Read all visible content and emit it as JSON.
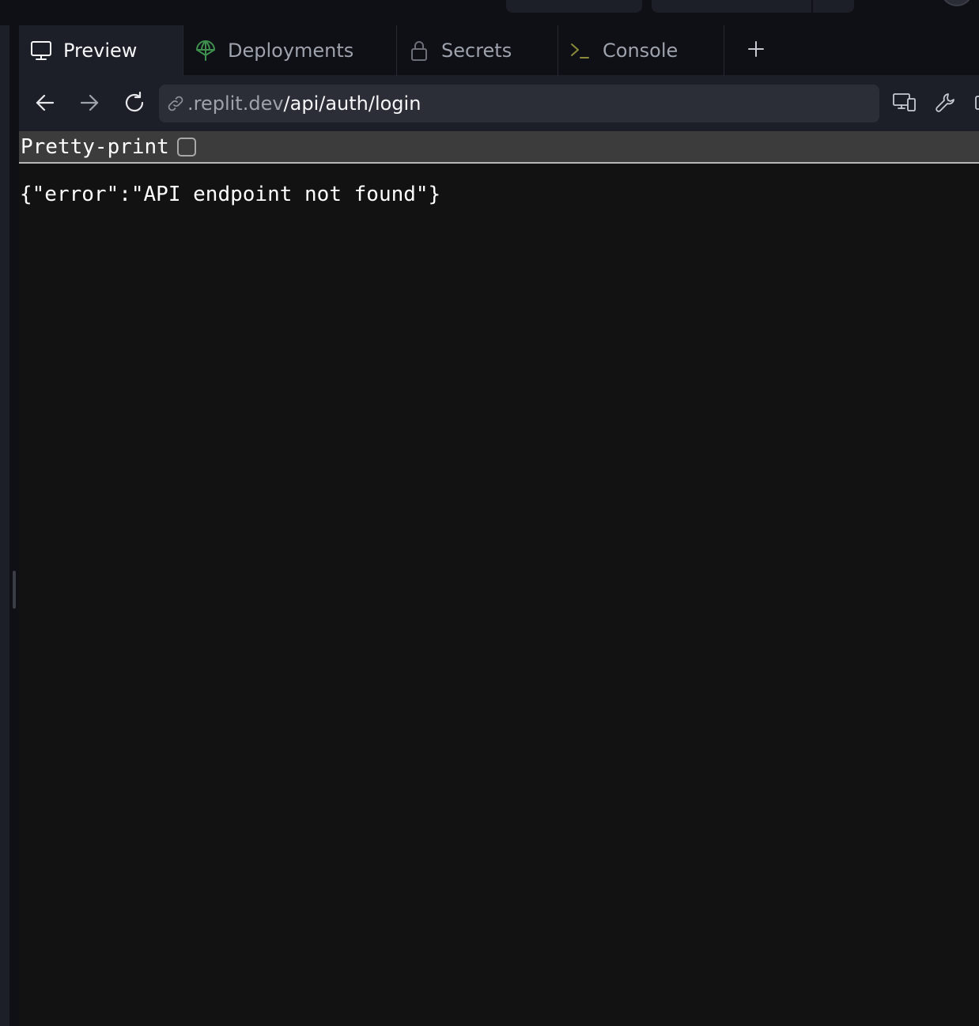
{
  "tabs": [
    {
      "label": "Preview",
      "icon": "monitor-icon",
      "active": true
    },
    {
      "label": "Deployments",
      "icon": "deployments-icon",
      "active": false
    },
    {
      "label": "Secrets",
      "icon": "lock-icon",
      "active": false
    },
    {
      "label": "Console",
      "icon": "terminal-icon",
      "active": false
    }
  ],
  "address_bar": {
    "url_domain": ".replit.dev",
    "url_path": "/api/auth/login"
  },
  "json_viewer": {
    "pretty_print_label": "Pretty-print",
    "pretty_print_checked": false,
    "body": "{\"error\":\"API endpoint not found\"}"
  },
  "colors": {
    "background": "#0e1015",
    "panel": "#1c1f27",
    "url_field": "#2b2e37",
    "text_primary": "#f5f6f8",
    "text_secondary": "#9da2ad",
    "deployments_accent": "#3f8f4f",
    "console_accent": "#8a8a3a",
    "content_bg": "#121212"
  }
}
